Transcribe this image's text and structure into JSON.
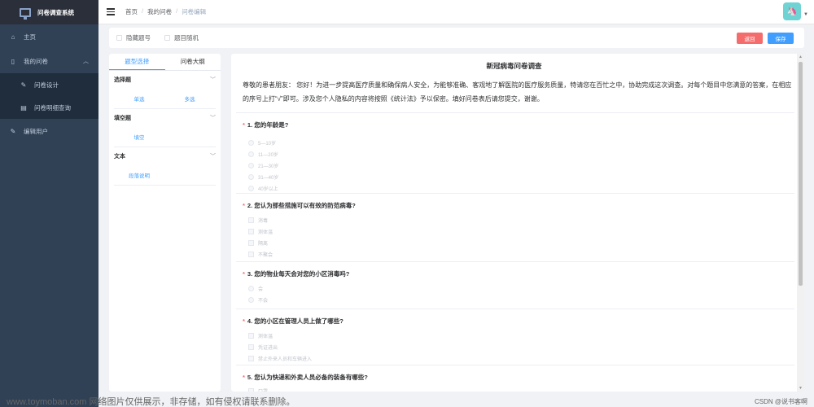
{
  "sidebar": {
    "logo_text": "问卷调查系统",
    "items": [
      {
        "label": "主页",
        "icon": "home-icon"
      },
      {
        "label": "我的问卷",
        "icon": "book-icon"
      },
      {
        "label": "问卷设计",
        "icon": "edit-icon"
      },
      {
        "label": "问卷明细查询",
        "icon": "document-icon"
      },
      {
        "label": "编辑用户",
        "icon": "edit-user-icon"
      }
    ]
  },
  "header": {
    "breadcrumb": [
      "首页",
      "我的问卷",
      "问卷编辑"
    ],
    "avatar": "🦄"
  },
  "toolbar": {
    "hide_number": "隐藏题号",
    "random_order": "题目随机",
    "back_label": "返回",
    "save_label": "保存"
  },
  "left_panel": {
    "tabs": [
      "题型选择",
      "问卷大纲"
    ],
    "groups": [
      {
        "title": "选择题",
        "items": [
          "单选",
          "多选"
        ]
      },
      {
        "title": "填空题",
        "items": [
          "填空"
        ]
      },
      {
        "title": "文本",
        "items": [
          "段落说明"
        ]
      }
    ]
  },
  "survey": {
    "title": "新冠病毒问卷调查",
    "intro": "尊敬的患者朋友：  您好！为进一步提高医疗质量和确保病人安全，为能够准确、客观地了解医院的医疗服务质量，特请您在百忙之中，协助完成这次调查。对每个题目中您满意的答案，在相应的序号上打“√”即可。涉及您个人隐私的内容将按照《统计法》予以保密。填好问卷表后请您提交，谢谢。",
    "questions": [
      {
        "title": "1. 您的年龄是?",
        "options": [
          "5—10岁",
          "11—20岁",
          "21—30岁",
          "31—40岁",
          "40岁以上"
        ]
      },
      {
        "title": "2. 您认为那些措施可以有效的防范病毒?",
        "options": [
          "消毒",
          "测体温",
          "隔离",
          "不聚会"
        ]
      },
      {
        "title": "3. 您的物业每天会对您的小区消毒吗?",
        "options": [
          "会",
          "不会"
        ]
      },
      {
        "title": "4. 您的小区在管理人员上做了哪些?",
        "options": [
          "测体温",
          "凭证进出",
          "禁止外来人员和车辆进入"
        ]
      },
      {
        "title": "5. 您认为快递和外卖人员必备的装备有哪些?",
        "options": [
          "口罩"
        ]
      }
    ]
  },
  "footer": {
    "watermark": "www.toymoban.com 网络图片仅供展示，非存储，如有侵权请联系删除。",
    "csdn": "CSDN @说书客啊"
  }
}
